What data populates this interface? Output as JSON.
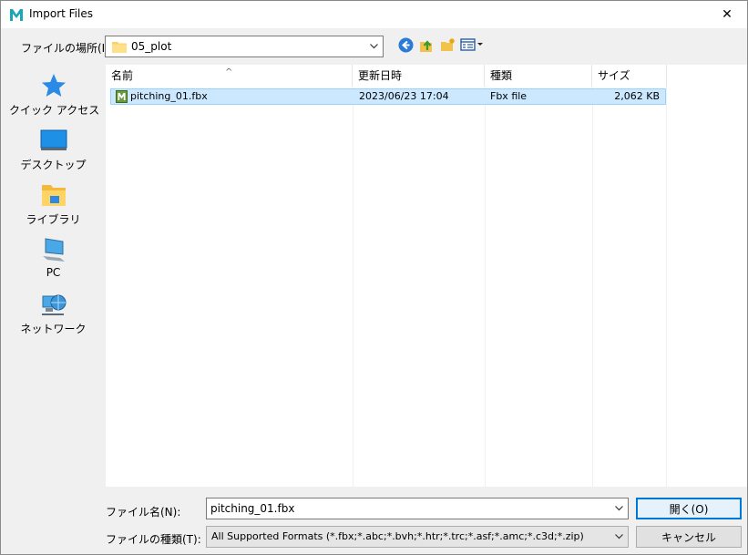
{
  "window": {
    "title": "Import Files",
    "close_glyph": "✕"
  },
  "location": {
    "label": "ファイルの場所(I):",
    "value": "05_plot"
  },
  "places": [
    {
      "label": "クイック アクセス",
      "icon": "quick-access-star-icon"
    },
    {
      "label": "デスクトップ",
      "icon": "desktop-icon"
    },
    {
      "label": "ライブラリ",
      "icon": "library-icon"
    },
    {
      "label": "PC",
      "icon": "pc-icon"
    },
    {
      "label": "ネットワーク",
      "icon": "network-icon"
    }
  ],
  "columns": {
    "name": "名前",
    "date": "更新日時",
    "type": "種類",
    "size": "サイズ"
  },
  "files": [
    {
      "name": "pitching_01.fbx",
      "date": "2023/06/23 17:04",
      "type": "Fbx file",
      "size": "2,062 KB"
    }
  ],
  "filename": {
    "label": "ファイル名(N):",
    "value": "pitching_01.fbx"
  },
  "filetype": {
    "label": "ファイルの種類(T):",
    "value": "All Supported Formats (*.fbx;*.abc;*.bvh;*.htr;*.trc;*.asf;*.amc;*.c3d;*.zip)"
  },
  "buttons": {
    "open": "開く(O)",
    "cancel": "キャンセル"
  },
  "colors": {
    "accent": "#0078d7",
    "selection": "#cce8ff",
    "brand": "#1ba6b4"
  }
}
